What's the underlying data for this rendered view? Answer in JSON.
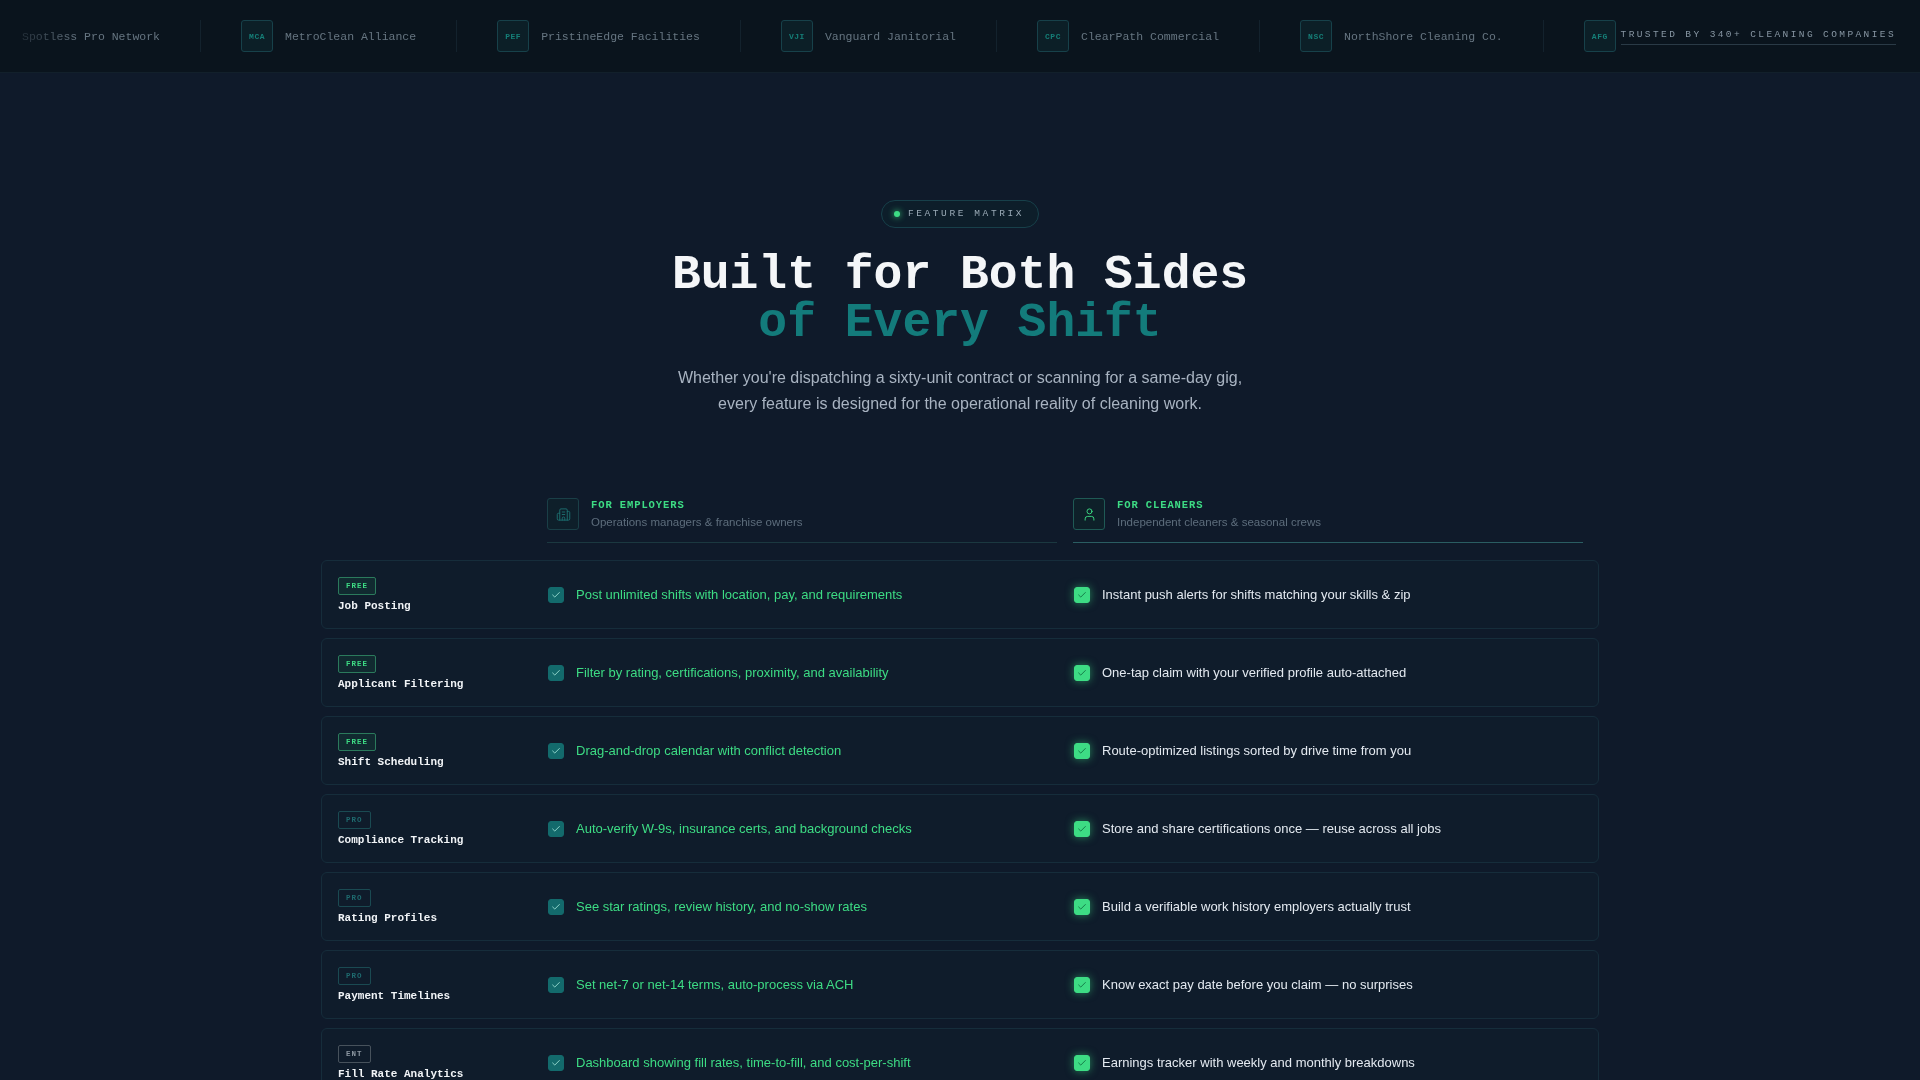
{
  "logo_strip": {
    "companies": [
      {
        "name": "Spotless Pro Network"
      },
      {
        "badge": "MCA",
        "name": "MetroClean Alliance"
      },
      {
        "badge": "PEF",
        "name": "PristineEdge Facilities"
      },
      {
        "badge": "VJI",
        "name": "Vanguard Janitorial"
      },
      {
        "badge": "CPC",
        "name": "ClearPath Commercial"
      },
      {
        "badge": "NSC",
        "name": "NorthShore Cleaning Co."
      },
      {
        "badge": "AFG"
      }
    ],
    "caption": "TRUSTED BY 340+ CLEANING COMPANIES"
  },
  "hero": {
    "eyebrow": "FEATURE MATRIX",
    "title": "Built for Both Sides",
    "title_accent": "of Every Shift",
    "description": "Whether you're dispatching a sixty-unit contract or scanning for a same-day gig, every feature is designed for the operational reality of cleaning work."
  },
  "matrix": {
    "columns": [
      {
        "kind": "employer",
        "title": "FOR EMPLOYERS",
        "subtitle": "Operations managers & franchise owners"
      },
      {
        "kind": "cleaner",
        "title": "FOR CLEANERS",
        "subtitle": "Independent cleaners & seasonal crews"
      }
    ],
    "rows": [
      {
        "tier": {
          "kind": "free",
          "label": "FREE"
        },
        "feature": "Job Posting",
        "cells": [
          {
            "text": "Post unlimited shifts with location, pay, and requirements",
            "checked": true
          },
          {
            "text": "Instant push alerts for shifts matching your skills & zip",
            "checked": true
          }
        ]
      },
      {
        "tier": {
          "kind": "free",
          "label": "FREE"
        },
        "feature": "Applicant Filtering",
        "cells": [
          {
            "text": "Filter by rating, certifications, proximity, and availability",
            "checked": true
          },
          {
            "text": "One-tap claim with your verified profile auto-attached",
            "checked": true
          }
        ]
      },
      {
        "tier": {
          "kind": "free",
          "label": "FREE"
        },
        "feature": "Shift Scheduling",
        "cells": [
          {
            "text": "Drag-and-drop calendar with conflict detection",
            "checked": true
          },
          {
            "text": "Route-optimized listings sorted by drive time from you",
            "checked": true
          }
        ]
      },
      {
        "tier": {
          "kind": "pro",
          "label": "PRO"
        },
        "feature": "Compliance Tracking",
        "cells": [
          {
            "text": "Auto-verify W-9s, insurance certs, and background checks",
            "checked": true
          },
          {
            "text": "Store and share certifications once — reuse across all jobs",
            "checked": true
          }
        ]
      },
      {
        "tier": {
          "kind": "pro",
          "label": "PRO"
        },
        "feature": "Rating Profiles",
        "cells": [
          {
            "text": "See star ratings, review history, and no-show rates",
            "checked": true
          },
          {
            "text": "Build a verifiable work history employers actually trust",
            "checked": true
          }
        ]
      },
      {
        "tier": {
          "kind": "pro",
          "label": "PRO"
        },
        "feature": "Payment Timelines",
        "cells": [
          {
            "text": "Set net-7 or net-14 terms, auto-process via ACH",
            "checked": true
          },
          {
            "text": "Know exact pay date before you claim — no surprises",
            "checked": true
          }
        ]
      },
      {
        "tier": {
          "kind": "ent",
          "label": "ENT"
        },
        "feature": "Fill Rate Analytics",
        "cells": [
          {
            "text": "Dashboard showing fill rates, time-to-fill, and cost-per-shift",
            "checked": true
          },
          {
            "text": "Earnings tracker with weekly and monthly breakdowns",
            "checked": true
          }
        ]
      }
    ]
  }
}
